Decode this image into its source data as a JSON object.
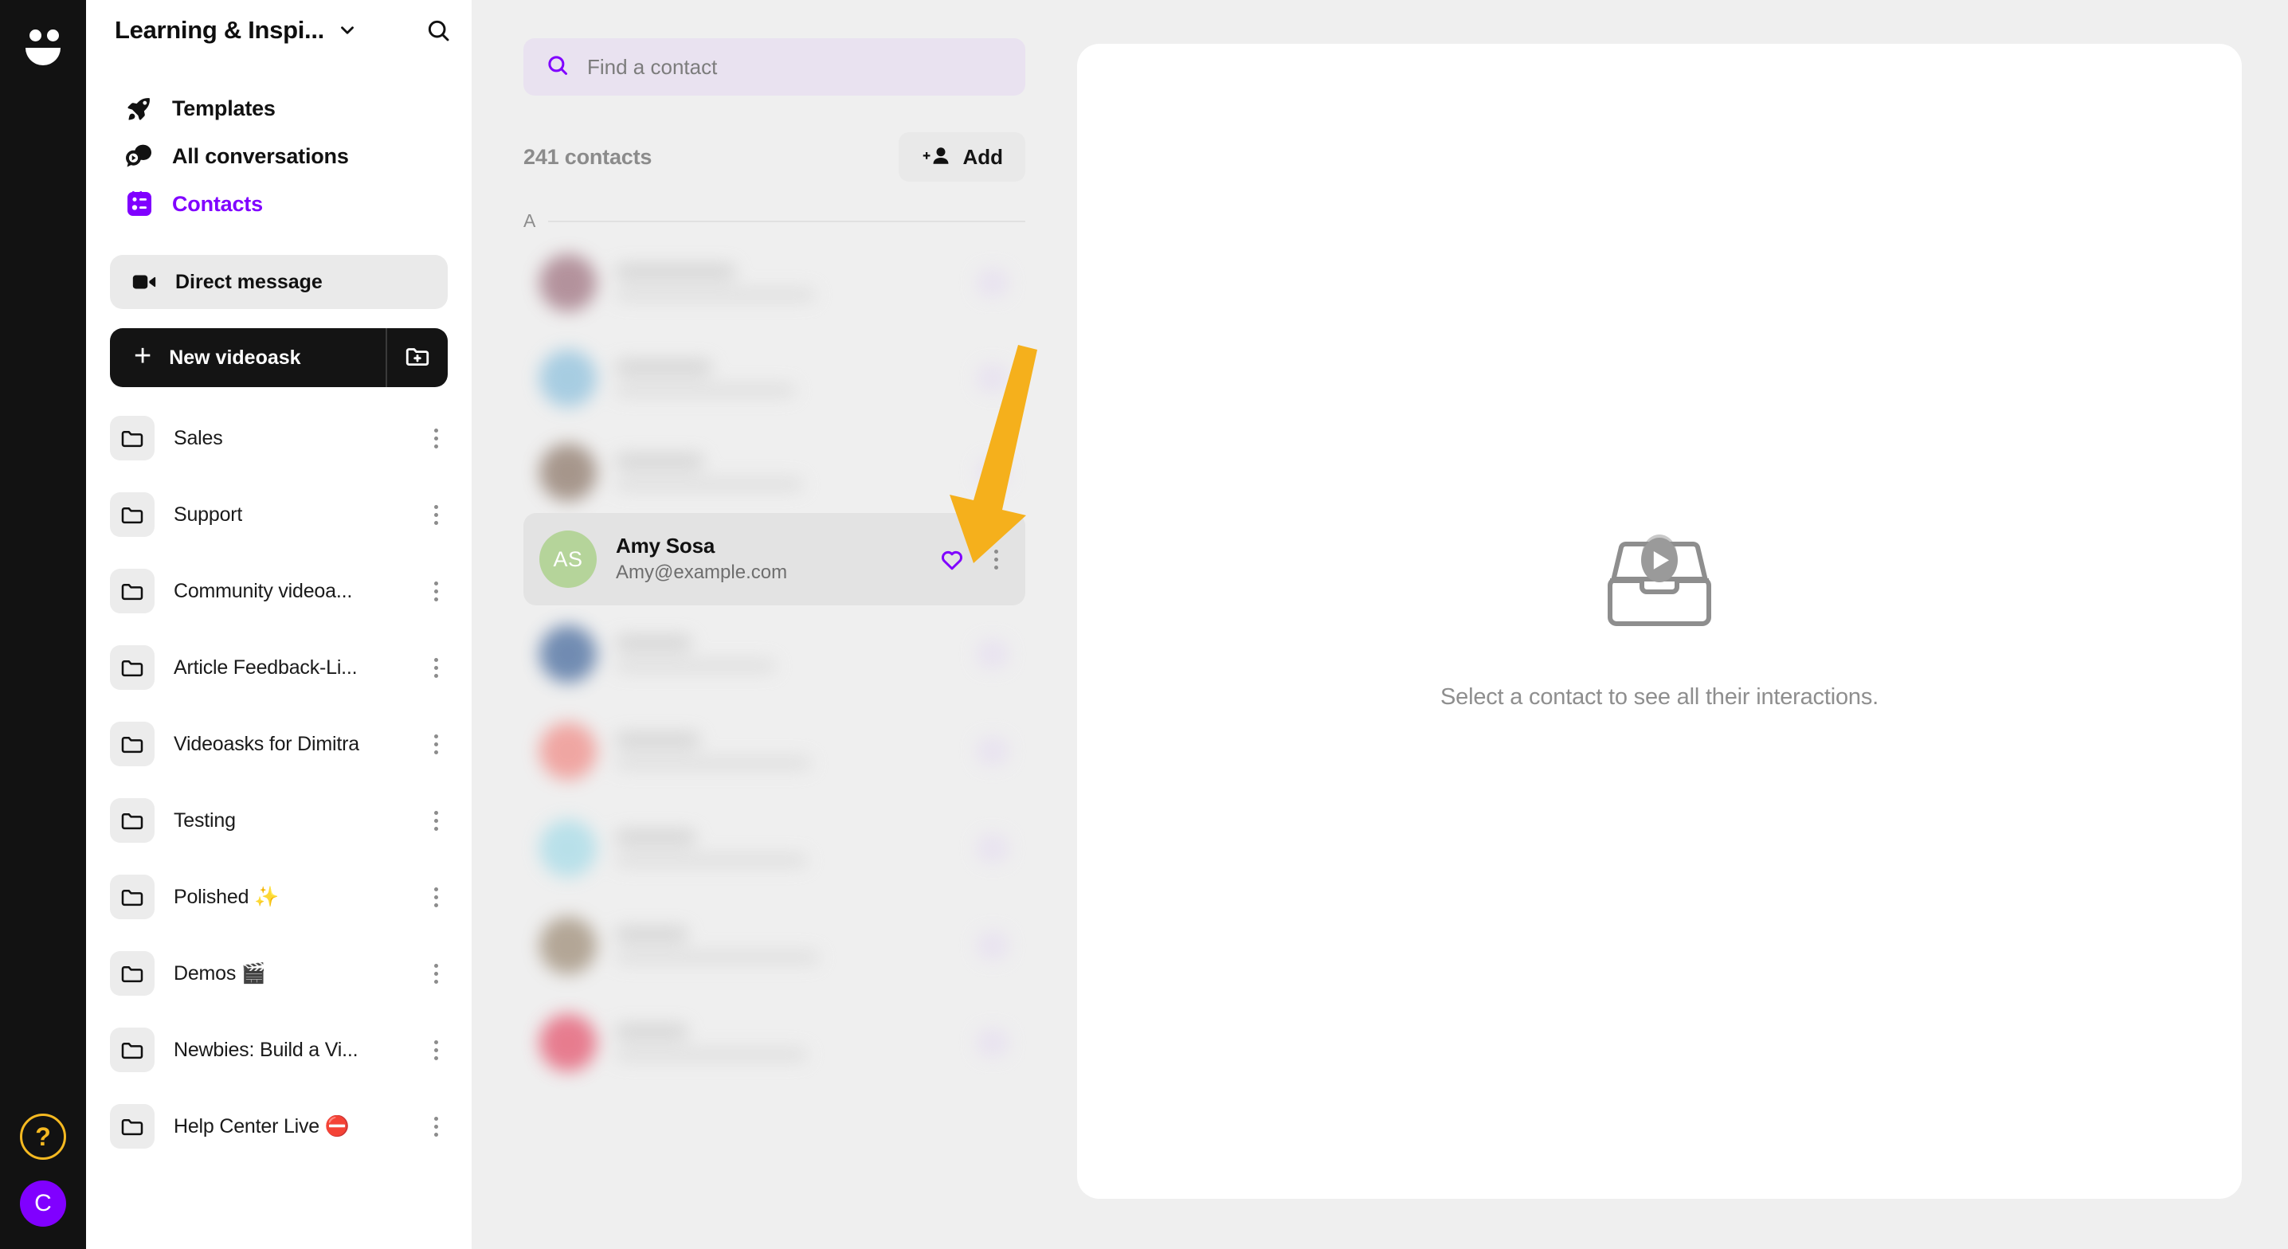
{
  "app": {
    "name": "videoask",
    "logo_icon": "videoask-smiley-logo"
  },
  "rail": {
    "help_label": "?",
    "help_icon": "question-mark-icon",
    "avatar_initial": "C",
    "avatar_color": "#8000ff",
    "help_color": "#f5b921"
  },
  "sidebar": {
    "workspace_title": "Learning & Inspi...",
    "workspace_chevron_icon": "chevron-down-icon",
    "search_icon": "search-icon",
    "nav": [
      {
        "label": "Templates",
        "icon": "rocket-icon",
        "active": false
      },
      {
        "label": "All conversations",
        "icon": "conversations-play-icon",
        "active": false
      },
      {
        "label": "Contacts",
        "icon": "contacts-list-icon",
        "active": true
      }
    ],
    "direct_message": {
      "label": "Direct message",
      "icon": "video-camera-icon"
    },
    "new_videoask": {
      "label": "New videoask",
      "plus": "+",
      "folder_icon": "new-folder-icon"
    },
    "folders": [
      {
        "label": "Sales"
      },
      {
        "label": "Support"
      },
      {
        "label": "Community videoa..."
      },
      {
        "label": "Article Feedback-Li..."
      },
      {
        "label": "Videoasks for Dimitra"
      },
      {
        "label": "Testing"
      },
      {
        "label": "Polished ✨"
      },
      {
        "label": "Demos 🎬"
      },
      {
        "label": "Newbies: Build a Vi..."
      },
      {
        "label": "Help Center Live ⛔"
      }
    ],
    "folder_icon": "folder-icon",
    "kebab_icon": "kebab-menu-icon",
    "accent_color": "#8000ff"
  },
  "contacts_panel": {
    "search_placeholder": "Find a contact",
    "search_value": "",
    "search_icon": "search-icon",
    "count_label": "241 contacts",
    "add_button": {
      "label": "Add",
      "icon": "add-person-icon",
      "plus": "+"
    },
    "section_letter": "A",
    "favorite_icon": "heart-icon",
    "kebab_icon": "kebab-menu-icon",
    "selected_contact": {
      "initials": "AS",
      "name": "Amy Sosa",
      "email": "Amy@example.com",
      "avatar_color": "#b5d49a",
      "favorited": false
    },
    "blurred_rows": [
      {
        "avatar_color": "#9d6f7d"
      },
      {
        "avatar_color": "#8cc0dd"
      },
      {
        "avatar_color": "#8b7566"
      },
      {
        "avatar_color": "#41669b"
      },
      {
        "avatar_color": "#f08a85"
      },
      {
        "avatar_color": "#a4dbe8"
      },
      {
        "avatar_color": "#9c8a74"
      },
      {
        "avatar_color": "#e4506a"
      }
    ]
  },
  "detail_panel": {
    "empty_message": "Select a contact to see all their interactions.",
    "empty_icon": "inbox-play-icon"
  },
  "annotation": {
    "arrow_icon": "down-arrow-annotation",
    "arrow_color": "#f5b01c"
  }
}
